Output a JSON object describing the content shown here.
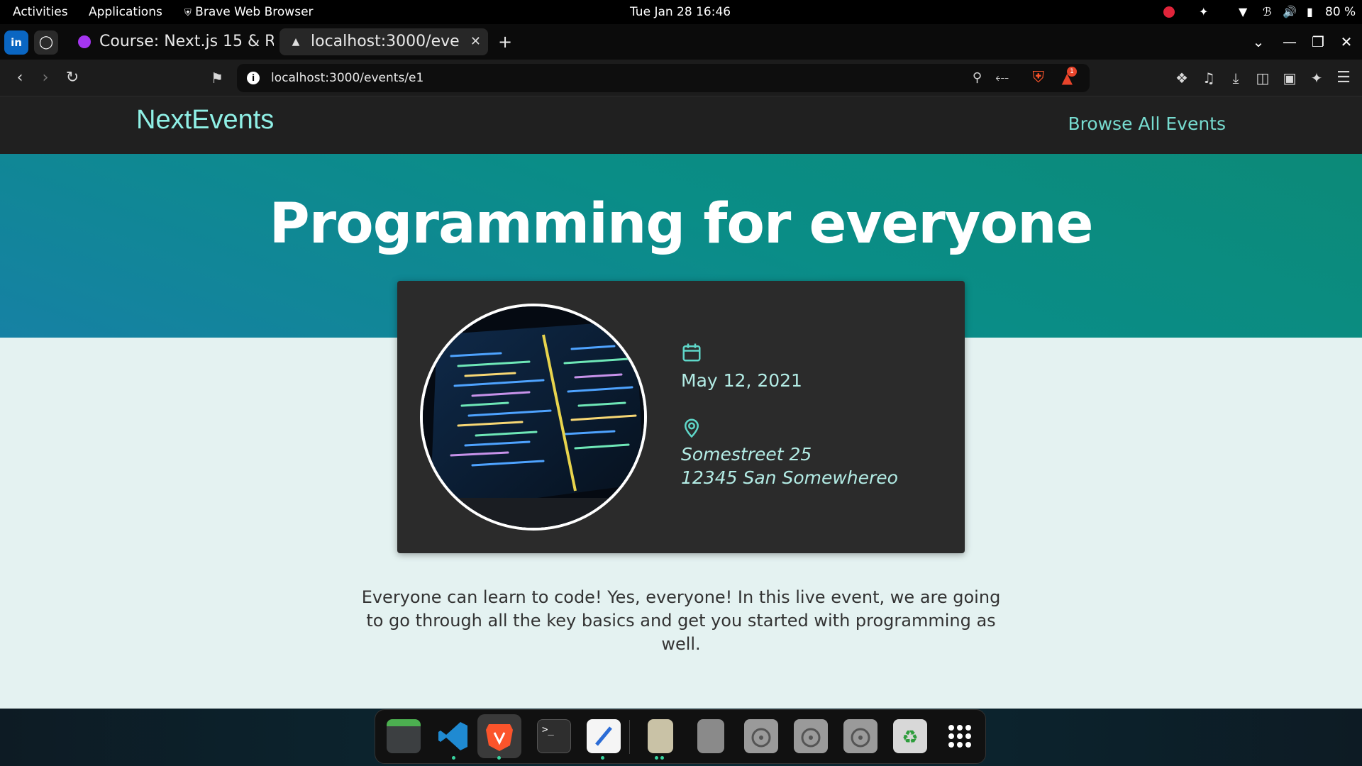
{
  "os": {
    "activities": "Activities",
    "applications": "Applications",
    "active_app": "Brave Web Browser",
    "clock": "Tue Jan 28  16:46",
    "battery": "80 %"
  },
  "browser": {
    "tabs": [
      {
        "label": "Course: Next.js 15 & R"
      },
      {
        "label": "localhost:3000/eve"
      }
    ],
    "new_tab": "+",
    "url": "localhost:3000/events/e1",
    "notification_count": "1"
  },
  "site": {
    "logo": "NextEvents",
    "nav_link": "Browse All Events"
  },
  "event": {
    "title": "Programming for everyone",
    "date": "May 12, 2021",
    "address_line1": "Somestreet 25",
    "address_line2": "12345 San Somewhereo",
    "description": "Everyone can learn to code! Yes, everyone! In this live event, we are going to go through all the key basics and get you started with programming as well.",
    "image_subject": "laptop-screen-with-code"
  },
  "colors": {
    "accent": "#77dcd0",
    "hero_start": "#1681a4",
    "hero_end": "#0c8a78",
    "card": "#2b2b2b"
  },
  "dock": {
    "apps": [
      "files-icon",
      "vscode-icon",
      "brave-icon",
      "terminal-icon",
      "text-editor-icon",
      "archive-icon",
      "disk-icon",
      "disc-icon-1",
      "disc-icon-2",
      "disc-icon-3",
      "trash-icon",
      "app-grid-icon"
    ]
  }
}
